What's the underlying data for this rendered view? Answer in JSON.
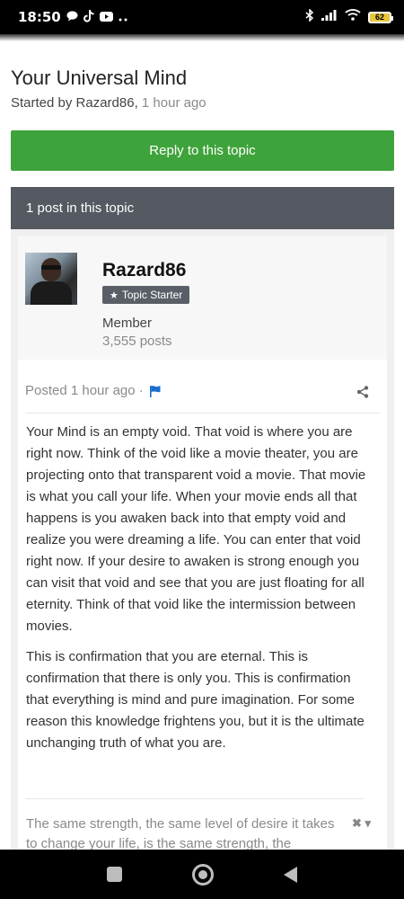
{
  "status_bar": {
    "time": "18:50",
    "battery": "62",
    "left_icons": [
      "chat-bubble-icon",
      "tiktok-icon",
      "youtube-icon",
      "more-dots-icon"
    ],
    "right_icons": [
      "bluetooth-icon",
      "signal-icon",
      "wifi-icon",
      "battery-icon"
    ]
  },
  "topic": {
    "title": "Your Universal Mind",
    "started_by_prefix": "Started by Razard86, ",
    "started_time": "1 hour ago"
  },
  "reply_button": {
    "label": "Reply to this topic"
  },
  "posts_header": {
    "label": "1 post in this topic"
  },
  "post": {
    "author": {
      "name": "Razard86",
      "badge": "Topic Starter",
      "rank": "Member",
      "post_count": "3,555 posts"
    },
    "posted_label": "Posted 1 hour ago ·",
    "paragraphs": [
      "Your Mind is an empty void. That void is where you are right now. Think of the void like a movie theater, you are projecting onto that transparent void a movie. That movie is what you call your life. When your movie ends all that happens is you awaken back into that empty void and realize you were dreaming a life. You can enter that void right now. If your desire to awaken is strong enough you can visit that void and see that you are just floating for all eternity. Think of that void like the intermission between movies.",
      "This is confirmation that you are eternal. This is confirmation that there is only you. This is confirmation that everything is mind and pure imagination. For some reason this knowledge frightens you, but it is the ultimate unchanging truth of what you are."
    ],
    "signature": "The same strength, the same level of desire it takes to change your life, is the same strength, the"
  },
  "colors": {
    "reply_button": "#3fa33b",
    "posts_header": "#555961",
    "flag": "#1a6ecc",
    "battery": "#e8c63a"
  }
}
